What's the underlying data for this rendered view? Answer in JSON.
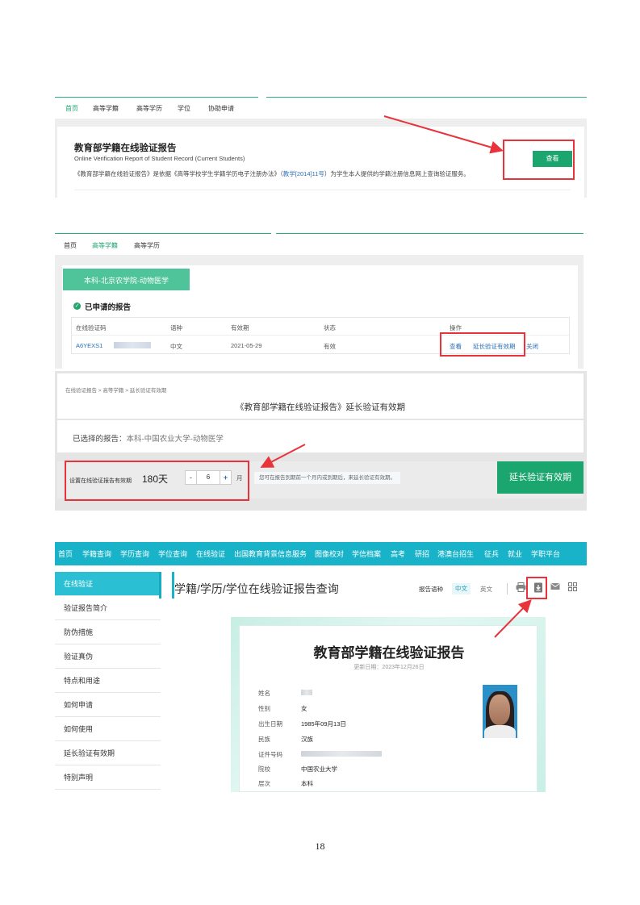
{
  "shot1": {
    "nav": [
      "首页",
      "高等学籍",
      "高等学历",
      "学位",
      "协助申请"
    ],
    "title": "教育部学籍在线验证报告",
    "subtitle": "Online Verification Report of Student Record (Current Students)",
    "desc_before": "《教育部学籍在线验证报告》是依据《高等学校学生学籍学历电子注册办法》（",
    "desc_link": "教学[2014]11号",
    "desc_after": "）为学生本人提供的学籍注册信息网上查询验证服务。",
    "view_button": "查看"
  },
  "shot2": {
    "nav": [
      "首页",
      "高等学籍",
      "高等学历"
    ],
    "stamp": "本科-北京农学院-动物医学",
    "heading": "已申请的报告",
    "columns": [
      "在线验证码",
      "语种",
      "有效期",
      "状态",
      "操作"
    ],
    "row": {
      "code": "A6YEXS1",
      "lang": "中文",
      "expiry": "2021-05-29",
      "status": "有效",
      "actions": [
        "查看",
        "延长验证有效期",
        "关闭"
      ]
    }
  },
  "shot3": {
    "breadcrumb": "在线验证报告 > 高等学籍 > 延长验证有效期",
    "title": "《教育部学籍在线验证报告》延长验证有效期",
    "selected_label": "已选择的报告：",
    "selected_value": "本科-中国农业大学-动物医学",
    "set_label": "设置在线验证报告有效期",
    "days": "180天",
    "minus": "-",
    "months_value": "6",
    "plus": "+",
    "unit": "月",
    "hint": "您可在报告到期前一个月内或到期后，来延长验证有效期。",
    "extend_button": "延长验证有效期"
  },
  "shot4": {
    "topnav": [
      "首页",
      "学籍查询",
      "学历查询",
      "学位查询",
      "在线验证",
      "出国教育背景信息服务",
      "图像校对",
      "学信档案",
      "高考",
      "研招",
      "港澳台招生",
      "征兵",
      "就业",
      "学职平台"
    ],
    "sidebar": [
      "在线验证",
      "验证报告简介",
      "防伪措施",
      "验证真伪",
      "特点和用途",
      "如何申请",
      "如何使用",
      "延长验证有效期",
      "特别声明"
    ],
    "main_title": "学籍/学历/学位在线验证报告查询",
    "lang_label": "报告语种",
    "lang_zh": "中文",
    "lang_en": "英文",
    "cert_title": "教育部学籍在线验证报告",
    "cert_date": "更新日期：2023年12月26日",
    "fields": {
      "name_label": "姓名",
      "gender_label": "性别",
      "gender": "女",
      "birth_label": "出生日期",
      "birth": "1985年09月13日",
      "ethnicity_label": "民族",
      "ethnicity": "汉族",
      "id_label": "证件号码",
      "school_label": "院校",
      "school": "中国农业大学",
      "level_label": "层次",
      "level": "本科"
    },
    "icons": [
      "print-icon",
      "download-icon",
      "mail-icon",
      "qrcode-icon"
    ]
  },
  "page_number": "18",
  "colors": {
    "green": "#1aa66e",
    "teal": "#19b3c9",
    "red_annotation": "#e8333a",
    "link_blue": "#2b6fb8"
  }
}
